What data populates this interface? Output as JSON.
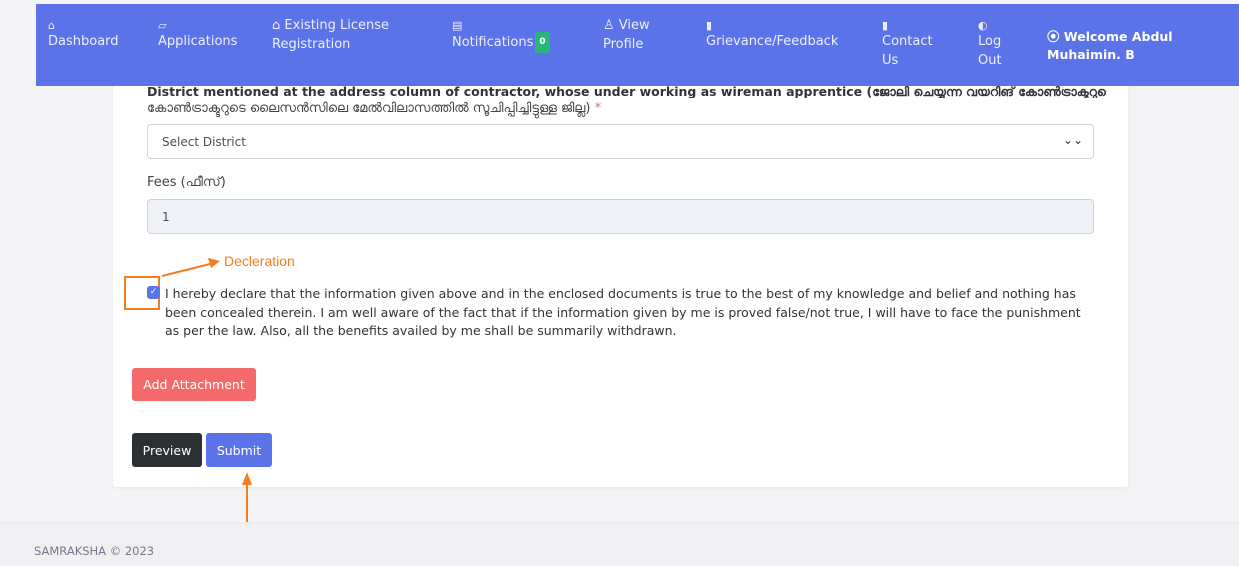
{
  "nav": {
    "items": [
      {
        "icon": "⌂",
        "label": "Dashboard"
      },
      {
        "icon": "▱",
        "label": "Applications"
      },
      {
        "icon": "⌂",
        "label": "Existing License Registration"
      },
      {
        "icon": "▤",
        "label": "Notifications",
        "badge": "0"
      },
      {
        "icon": "♙",
        "label": "View Profile"
      },
      {
        "icon": "▮",
        "label": "Grievance/Feedback"
      },
      {
        "icon": "▮",
        "label": "Contact Us"
      },
      {
        "icon": "◐",
        "label": "Log Out"
      }
    ],
    "welcome": "Welcome Abdul Muhaimin. B",
    "welcome_icon": "⦿"
  },
  "form": {
    "district_label_clipped": "District mentioned at the address column of contractor, whose under working as wireman apprentice (ജോലി ചെയ്യുന്ന വയറിങ് കോൺട്രാക്ടറുടെ ലൈസൻസിലെ മേൽവിലാസത്തിലെ ജില്ല)",
    "district_label_mal": "കോൺട്രാക്ടറുടെ ലൈസൻസിലെ മേൽവിലാസത്തിൽ സൂചിപ്പിച്ചിട്ടുള്ള ജില്ല)",
    "required_mark": "*",
    "district_placeholder": "Select District",
    "fees_label": "Fees (ഫീസ്)",
    "fees_value": "1",
    "declaration_text": "I hereby declare that the information given above and in the enclosed documents is true to the best of my knowledge and belief and nothing has been concealed therein. I am well aware of the fact that if the information given by me is proved false/not true, I will have to face the punishment as per the law. Also, all the benefits availed by me shall be summarily withdrawn.",
    "declaration_checked": true,
    "add_attachment": "Add Attachment",
    "preview": "Preview",
    "submit": "Submit"
  },
  "annotation": {
    "label": "Decleration",
    "color": "#f57c1f"
  },
  "footer": {
    "text": "SAMRAKSHA © 2023"
  },
  "colors": {
    "primary": "#5b73e8",
    "danger": "#f46a6a",
    "dark": "#2b3035",
    "success_badge": "#2ab57d"
  }
}
